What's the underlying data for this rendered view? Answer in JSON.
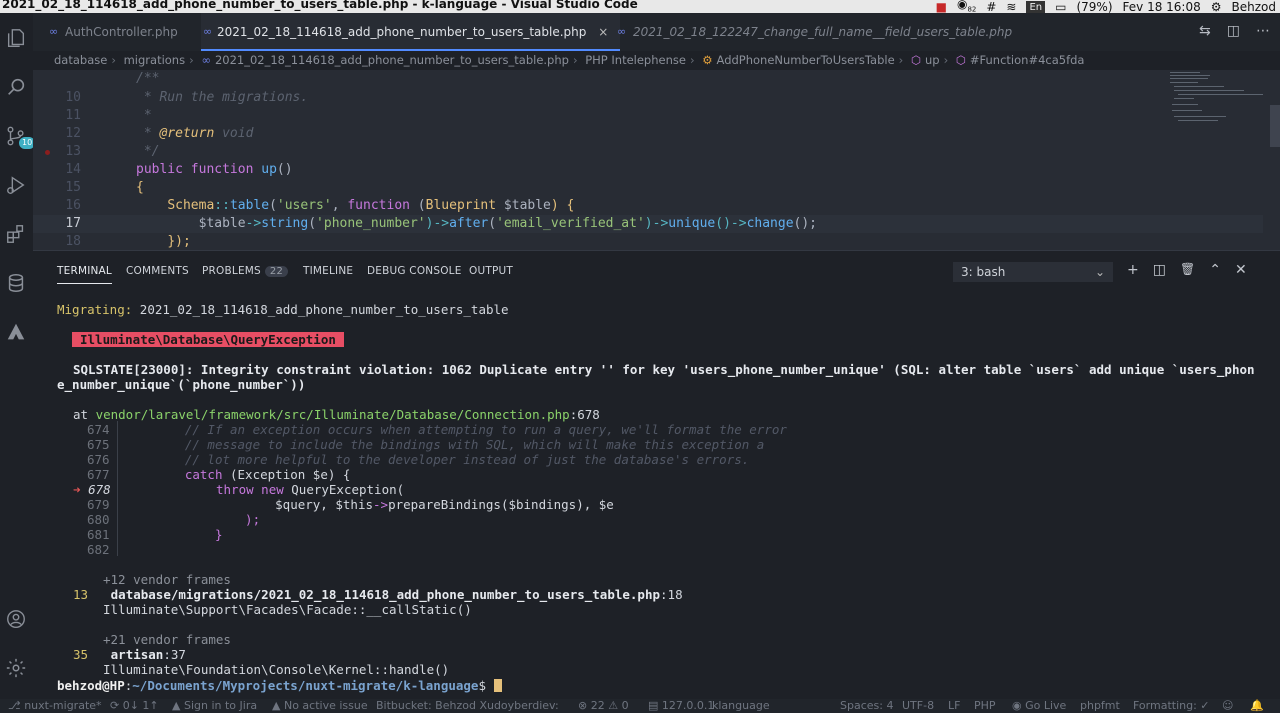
{
  "os": {
    "window_title": "2021_02_18_114618_add_phone_number_to_users_table.php - k-language - Visual Studio Code",
    "battery": "(79%)",
    "clock": "Fev 18 16:08",
    "user": "Behzod",
    "lang": "En",
    "notif_count": "82"
  },
  "tabs": [
    {
      "label": "AuthController.php"
    },
    {
      "label": "2021_02_18_114618_add_phone_number_to_users_table.php",
      "close": "×"
    },
    {
      "label": "2021_02_18_122247_change_full_name__field_users_table.php"
    }
  ],
  "breadcrumb": {
    "items": [
      "database",
      "migrations",
      "2021_02_18_114618_add_phone_number_to_users_table.php",
      "PHP Intelephense",
      "AddPhoneNumberToUsersTable",
      "up",
      "#Function#4ca5fda"
    ],
    "sep": "›"
  },
  "activity": {
    "scm_badge": "10"
  },
  "editor": {
    "lines": [
      {
        "n": "",
        "t": "/**"
      },
      {
        "n": "10",
        "t": " * Run the migrations."
      },
      {
        "n": "11",
        "t": " *"
      },
      {
        "n": "12",
        "t": " * @return void"
      },
      {
        "n": "13",
        "t": " */"
      },
      {
        "n": "14",
        "t": "public function up()"
      },
      {
        "n": "15",
        "t": "{"
      },
      {
        "n": "16",
        "t": "Schema::table('users', function (Blueprint $table) {"
      },
      {
        "n": "17",
        "t": "$table->string('phone_number')->after('email_verified_at')->unique()->change();"
      },
      {
        "n": "18",
        "t": "});"
      }
    ],
    "code": {
      "c0": "/**",
      "c1": " * Run the migrations.",
      "c2": " *",
      "c3a": " * ",
      "c3b": "@return",
      "c3c": " void",
      "c4": " */",
      "c5a": "public",
      "c5b": " function",
      "c5c": " up",
      "c5d": "()",
      "c6": "{",
      "c7a": "Schema",
      "c7b": "::",
      "c7c": "table",
      "c7d": "(",
      "c7e": "'users'",
      "c7f": ", ",
      "c7g": "function",
      "c7h": " (",
      "c7i": "Blueprint",
      "c7j": " $table",
      "c7k": ") {",
      "c8a": "$table",
      "c8b": "->",
      "c8c": "string",
      "c8d": "(",
      "c8e": "'phone_number'",
      "c8f": ")->",
      "c8g": "after",
      "c8h": "(",
      "c8i": "'email_verified_at'",
      "c8j": ")->",
      "c8k": "unique",
      "c8l": "()->",
      "c8m": "change",
      "c8n": "();",
      "c9": "});"
    }
  },
  "panel": {
    "tabs": [
      {
        "label": "TERMINAL"
      },
      {
        "label": "COMMENTS"
      },
      {
        "label": "PROBLEMS",
        "count": "22"
      },
      {
        "label": "TIMELINE"
      },
      {
        "label": "DEBUG CONSOLE"
      },
      {
        "label": "OUTPUT"
      }
    ],
    "terminal_select": "3: bash",
    "actions": {
      "add": "+",
      "split": "◫",
      "trash": "🗑",
      "maximize": "⌃",
      "close": "✕"
    }
  },
  "terminal": {
    "migrating_label": "Migrating:",
    "migrating_file": " 2021_02_18_114618_add_phone_number_to_users_table",
    "exception": "Illuminate\\Database\\QueryException",
    "sql1": "SQLSTATE[23000]: Integrity constraint violation: 1062 Duplicate entry '' for key 'users_phone_number_unique' (SQL: alter table `users` add unique `users_phon",
    "sql2": "e_number_unique`(`phone_number`))",
    "at": "at ",
    "at_path": "vendor/laravel/framework/src/Illuminate/Database/Connection.php",
    "at_line": ":678",
    "snippet": [
      {
        "n": "674",
        "code": "// If an exception occurs when attempting to run a query, we'll format the error"
      },
      {
        "n": "675",
        "code": "// message to include the bindings with SQL, which will make this exception a"
      },
      {
        "n": "676",
        "code": "// lot more helpful to the developer instead of just the database's errors."
      },
      {
        "n": "677",
        "code": "catch (Exception $e) {"
      },
      {
        "n": "678",
        "code": "throw new QueryException("
      },
      {
        "n": "679",
        "code": "$query, $this->prepareBindings($bindings), $e"
      },
      {
        "n": "680",
        "code": ");"
      },
      {
        "n": "681",
        "code": "}"
      },
      {
        "n": "682",
        "code": ""
      }
    ],
    "snip": {
      "arrow": "➜",
      "c677a": "catch",
      "c677b": " (Exception $e) {",
      "c678a": "throw",
      "c678b": " new",
      "c678c": " QueryException(",
      "c679a": "$query, $this",
      "c679b": "->",
      "c679c": "prepareBindings",
      "c679d": "($bindings), $e",
      "c680": ");",
      "c681": "}"
    },
    "frames": [
      {
        "vendor": "+12 vendor frames",
        "idx": "13",
        "path": "database/migrations/2021_02_18_114618_add_phone_number_to_users_table.php",
        "line": ":18",
        "call": "Illuminate\\Support\\Facades\\Facade::__callStatic()"
      },
      {
        "vendor": "+21 vendor frames",
        "idx": "35",
        "path": "artisan",
        "line": ":37",
        "call": "Illuminate\\Foundation\\Console\\Kernel::handle()"
      }
    ],
    "prompt_user": "behzod@HP",
    "prompt_colon": ":",
    "prompt_path": "~/Documents/Myprojects/nuxt-migrate/k-language",
    "prompt_sign": "$ "
  },
  "status": {
    "branch": "nuxt-migrate*",
    "sync": "0↓ 1↑",
    "jira": "Sign in to Jira",
    "issue": "No active issue",
    "bitbucket": "Bitbucket: Behzod Xudoyberdiev:",
    "problems": "⊗ 22 ⚠ 0",
    "host": "127.0.0.1",
    "project": "klanguage",
    "spaces": "Spaces: 4",
    "encoding": "UTF-8",
    "eol": "LF",
    "lang": "PHP",
    "golive": "Go Live",
    "phpfmt": "phpfmt",
    "formatting": "Formatting: ✓"
  }
}
